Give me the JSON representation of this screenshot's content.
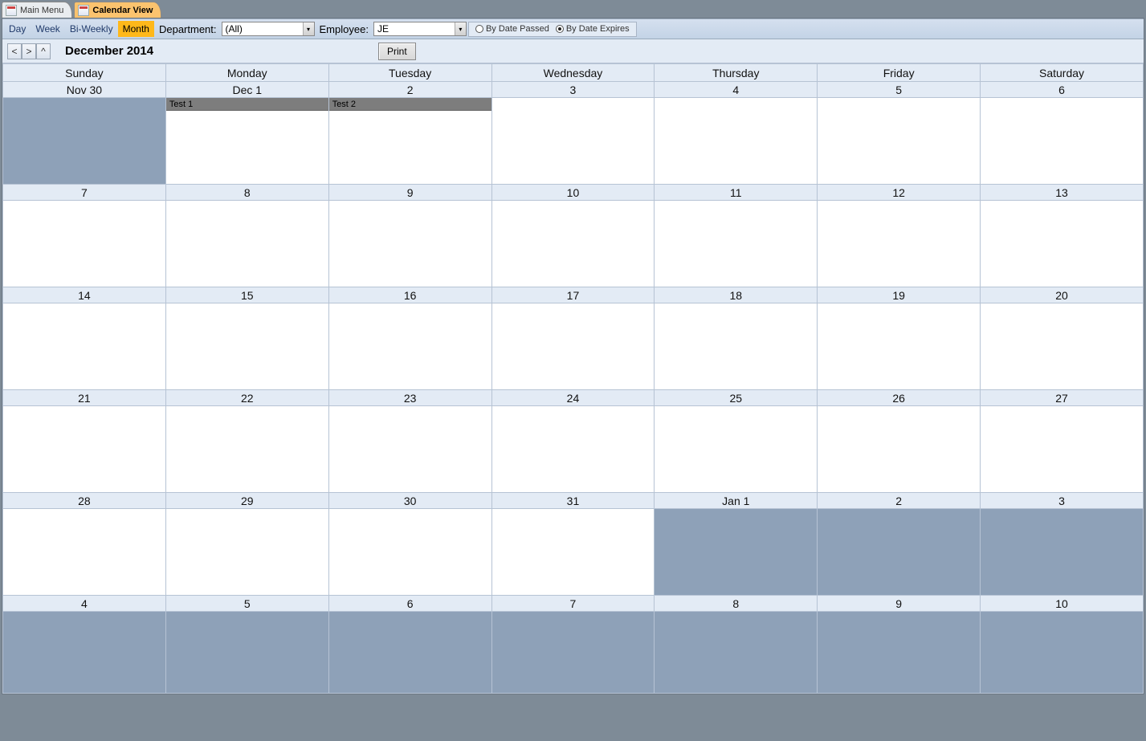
{
  "tabs": [
    {
      "label": "Main Menu",
      "active": false
    },
    {
      "label": "Calendar View",
      "active": true
    }
  ],
  "toolbar": {
    "views": {
      "day": "Day",
      "week": "Week",
      "biweekly": "Bi-Weekly",
      "month": "Month"
    },
    "active_view": "month",
    "department_label": "Department:",
    "department_value": "(All)",
    "employee_label": "Employee:",
    "employee_value": "JE",
    "radio_passed": "By Date Passed",
    "radio_expires": "By Date Expires",
    "radio_selected": "expires"
  },
  "nav": {
    "prev": "<",
    "next": ">",
    "up": "^",
    "title": "December 2014",
    "print": "Print"
  },
  "dow": [
    "Sunday",
    "Monday",
    "Tuesday",
    "Wednesday",
    "Thursday",
    "Friday",
    "Saturday"
  ],
  "weeks": [
    {
      "dates": [
        "Nov 30",
        "Dec 1",
        "2",
        "3",
        "4",
        "5",
        "6"
      ],
      "out": [
        true,
        false,
        false,
        false,
        false,
        false,
        false
      ],
      "events": [
        [],
        [
          {
            "t": "Test 1"
          }
        ],
        [
          {
            "t": "Test 2"
          }
        ],
        [],
        [],
        [],
        []
      ]
    },
    {
      "dates": [
        "7",
        "8",
        "9",
        "10",
        "11",
        "12",
        "13"
      ],
      "out": [
        false,
        false,
        false,
        false,
        false,
        false,
        false
      ],
      "events": [
        [],
        [],
        [],
        [],
        [],
        [],
        []
      ]
    },
    {
      "dates": [
        "14",
        "15",
        "16",
        "17",
        "18",
        "19",
        "20"
      ],
      "out": [
        false,
        false,
        false,
        false,
        false,
        false,
        false
      ],
      "events": [
        [],
        [],
        [],
        [],
        [],
        [],
        []
      ]
    },
    {
      "dates": [
        "21",
        "22",
        "23",
        "24",
        "25",
        "26",
        "27"
      ],
      "out": [
        false,
        false,
        false,
        false,
        false,
        false,
        false
      ],
      "events": [
        [],
        [],
        [],
        [],
        [],
        [],
        []
      ]
    },
    {
      "dates": [
        "28",
        "29",
        "30",
        "31",
        "Jan 1",
        "2",
        "3"
      ],
      "out": [
        false,
        false,
        false,
        false,
        true,
        true,
        true
      ],
      "events": [
        [],
        [],
        [],
        [],
        [],
        [],
        []
      ]
    },
    {
      "dates": [
        "4",
        "5",
        "6",
        "7",
        "8",
        "9",
        "10"
      ],
      "out": [
        true,
        true,
        true,
        true,
        true,
        true,
        true
      ],
      "events": [
        [],
        [],
        [],
        [],
        [],
        [],
        []
      ]
    }
  ]
}
